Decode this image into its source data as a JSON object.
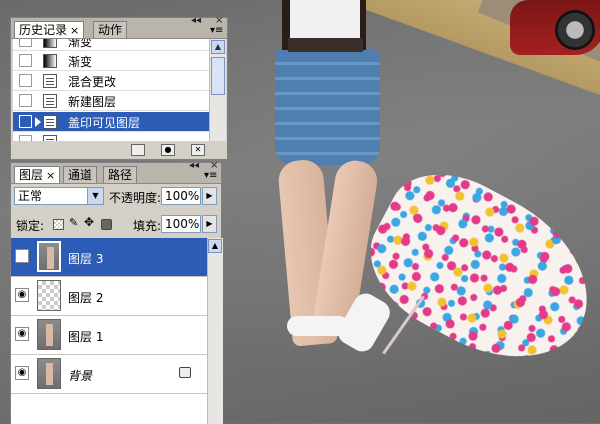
{
  "history_panel": {
    "tabs": [
      {
        "label": "历史记录",
        "active": true,
        "close": "×"
      },
      {
        "label": "动作",
        "active": false
      }
    ],
    "collapse_label": "◂◂",
    "close_label": "×",
    "menu_label": "▾≡",
    "items": [
      {
        "label": "渐变",
        "icon": "gradient-icon",
        "selected": false
      },
      {
        "label": "渐变",
        "icon": "gradient-icon",
        "selected": false
      },
      {
        "label": "混合更改",
        "icon": "history-state-icon",
        "selected": false
      },
      {
        "label": "新建图层",
        "icon": "history-state-icon",
        "selected": false
      },
      {
        "label": "盖印可见图层",
        "icon": "history-state-icon",
        "selected": true
      },
      {
        "label": "…",
        "icon": "history-state-icon",
        "selected": false
      }
    ],
    "footer_buttons": [
      "new-document-from-state",
      "new-snapshot",
      "delete-state"
    ]
  },
  "layers_panel": {
    "tabs": [
      {
        "label": "图层",
        "active": true,
        "close": "×"
      },
      {
        "label": "通道",
        "active": false
      },
      {
        "label": "路径",
        "active": false
      }
    ],
    "collapse_label": "◂◂",
    "close_label": "×",
    "menu_label": "▾≡",
    "blend_mode": "正常",
    "opacity_label": "不透明度:",
    "opacity_value": "100%",
    "lock_label": "锁定:",
    "fill_label": "填充:",
    "fill_value": "100%",
    "layers": [
      {
        "name": "图层 3",
        "selected": true,
        "visible": true,
        "thumb": "photo",
        "locked": false
      },
      {
        "name": "图层 2",
        "selected": false,
        "visible": true,
        "thumb": "transparent",
        "locked": false
      },
      {
        "name": "图层 1",
        "selected": false,
        "visible": true,
        "thumb": "photo",
        "locked": false
      },
      {
        "name": "背景",
        "selected": false,
        "visible": true,
        "thumb": "photo",
        "locked": true
      }
    ]
  },
  "colors": {
    "selection": "#2c5cb6",
    "panel_bg": "#d4d0c8"
  }
}
